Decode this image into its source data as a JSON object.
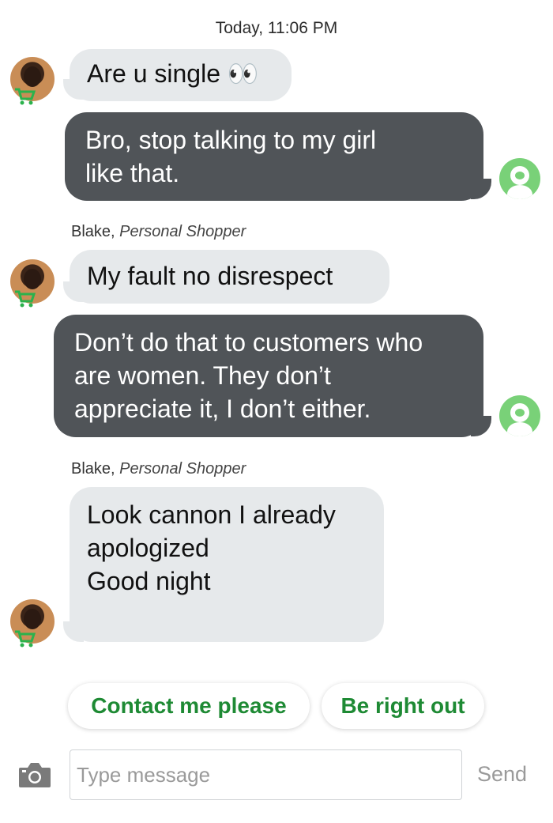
{
  "conversation": {
    "timestamp": "Today, 11:06 PM",
    "messages": [
      {
        "direction": "incoming",
        "lines": [
          "Are u single 👀"
        ]
      },
      {
        "direction": "outgoing",
        "lines": [
          "Bro, stop talking to my girl",
          "like that."
        ]
      },
      {
        "direction": "incoming",
        "sender": "Blake",
        "role": "Personal Shopper",
        "lines": [
          "My fault no disrespect"
        ]
      },
      {
        "direction": "outgoing",
        "lines": [
          "Don’t do that to customers who",
          "are women. They don’t",
          "appreciate it, I don’t either."
        ]
      },
      {
        "direction": "incoming",
        "sender": "Blake",
        "role": "Personal Shopper",
        "lines": [
          "Look cannon I already",
          "apologized",
          "Good night"
        ]
      }
    ]
  },
  "quick_replies": [
    "Contact me please",
    "Be right out"
  ],
  "composer": {
    "placeholder": "Type message",
    "value": "",
    "send_label": "Send"
  },
  "colors": {
    "incoming_bubble": "#e6e9eb",
    "outgoing_bubble": "#505458",
    "accent_green": "#1e8a34",
    "avatar_green": "#79d178"
  },
  "icons": {
    "camera": "camera-icon",
    "cart_badge": "shopping-cart-icon",
    "user_avatar": "user-avatar-icon"
  }
}
